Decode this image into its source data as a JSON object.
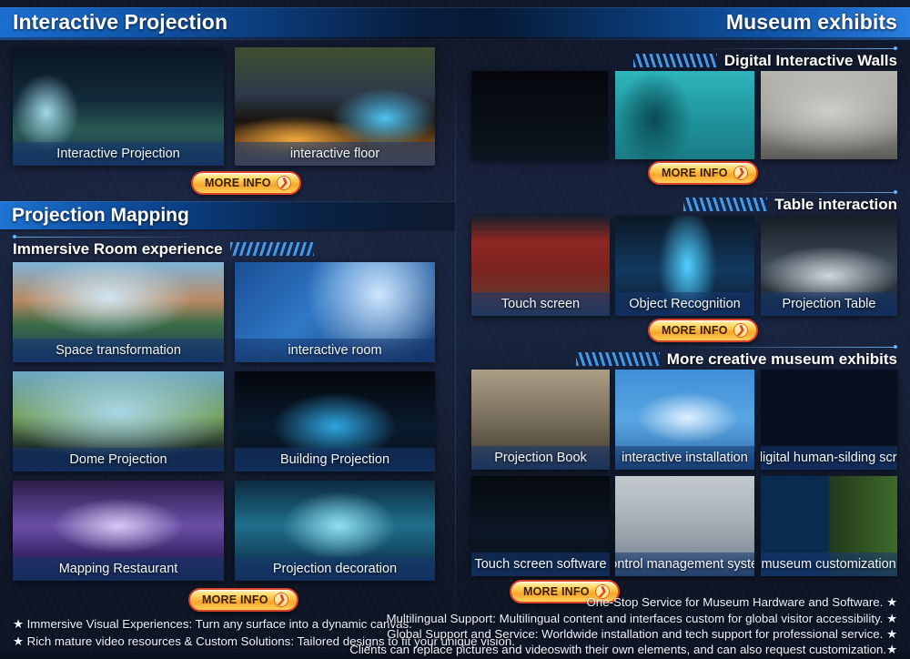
{
  "header": {
    "left_title": "Interactive Projection",
    "right_title": "Museum exhibits"
  },
  "left_column": {
    "interactive_projection": {
      "cards": [
        {
          "label": "Interactive Projection",
          "pic": "p-interactive-projection"
        },
        {
          "label": "interactive floor",
          "pic": "p-interactive-floor"
        }
      ],
      "more_info": "MORE INFO",
      "more_info_arrow": "chevron-right-icon"
    },
    "section_title": "Projection Mapping",
    "subsection_title": "Immersive Room experience",
    "mapping_cards": [
      {
        "label": "Space transformation",
        "pic": "p-space-transformation"
      },
      {
        "label": "interactive room",
        "pic": "p-interactive-room"
      },
      {
        "label": "Dome Projection",
        "pic": "p-dome-projection"
      },
      {
        "label": "Building Projection",
        "pic": "p-building-projection"
      },
      {
        "label": "Mapping Restaurant",
        "pic": "p-mapping-restaurant"
      },
      {
        "label": "Projection decoration",
        "pic": "p-projection-decoration"
      }
    ],
    "more_info": "MORE INFO",
    "footer_lines": [
      "★ Immersive Visual Experiences: Turn any surface into a dynamic canvas.",
      "★ Rich mature video resources & Custom Solutions: Tailored designs to fit your unique vision."
    ]
  },
  "right_column": {
    "walls": {
      "title": "Digital Interactive Walls",
      "cards": [
        {
          "label": "",
          "pic": "p-wall1"
        },
        {
          "label": "",
          "pic": "p-wall2"
        },
        {
          "label": "",
          "pic": "p-wall3"
        }
      ],
      "more_info": "MORE INFO"
    },
    "table": {
      "title": "Table interaction",
      "cards": [
        {
          "label": "Touch screen",
          "pic": "p-touch-screen"
        },
        {
          "label": "Object Recognition",
          "pic": "p-object-recognition"
        },
        {
          "label": "Projection Table",
          "pic": "p-projection-table"
        }
      ],
      "more_info": "MORE INFO"
    },
    "creative": {
      "title": "More creative museum exhibits",
      "row1": [
        {
          "label": "Projection Book",
          "pic": "p-projection-book"
        },
        {
          "label": "interactive installation",
          "pic": "p-interactive-installation"
        },
        {
          "label": "AI digital human-silding screen",
          "pic": "p-ai-digital"
        }
      ],
      "row2": [
        {
          "label": "Touch screen software",
          "pic": "p-touch-software"
        },
        {
          "label": "Control management system",
          "pic": "p-control-system"
        },
        {
          "label": "Theme museum customization service",
          "pic": "p-theme-museum"
        }
      ],
      "more_info": "MORE INFO"
    },
    "footer_lines": [
      "One-Stop Service for Museum Hardware and Software. ★",
      "Multilingual Support: Multilingual content and interfaces custom for global visitor accessibility. ★",
      "Global Support and Service: Worldwide installation and tech support for professional service. ★",
      "Clients can replace pictures and videoswith their own elements, and can also request customization.★"
    ]
  }
}
